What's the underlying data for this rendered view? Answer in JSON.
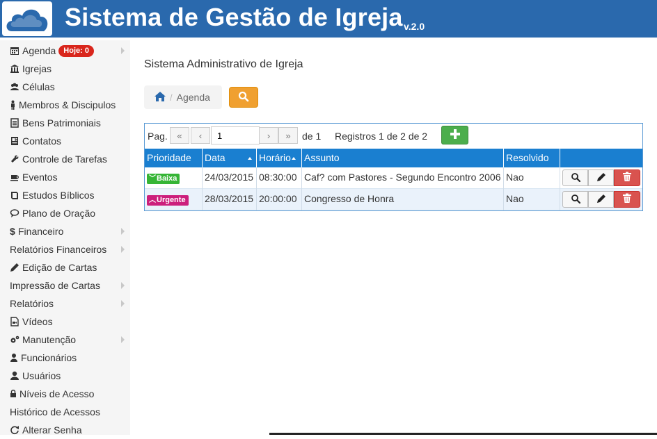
{
  "header": {
    "title": "Sistema de Gestão de Igreja",
    "version": "v.2.0"
  },
  "sidebar": {
    "items": [
      {
        "label": "Agenda",
        "icon": "calendar-icon",
        "badge": "Hoje: 0",
        "submenu": true
      },
      {
        "label": "Igrejas",
        "icon": "bank-icon",
        "submenu": false
      },
      {
        "label": "Células",
        "icon": "users-icon",
        "submenu": false
      },
      {
        "label": "Membros & Discipulos",
        "icon": "person-icon",
        "submenu": false
      },
      {
        "label": "Bens Patrimoniais",
        "icon": "list-icon",
        "submenu": false
      },
      {
        "label": "Contatos",
        "icon": "contacts-icon",
        "submenu": false
      },
      {
        "label": "Controle de Tarefas",
        "icon": "wrench-icon",
        "submenu": false
      },
      {
        "label": "Eventos",
        "icon": "coffee-icon",
        "submenu": false
      },
      {
        "label": "Estudos Bíblicos",
        "icon": "book-icon",
        "submenu": false
      },
      {
        "label": "Plano de Oração",
        "icon": "comment-icon",
        "submenu": false
      },
      {
        "label": "Financeiro",
        "icon": "dollar-icon",
        "submenu": true
      },
      {
        "label": "Relatórios Financeiros",
        "icon": "",
        "submenu": true
      },
      {
        "label": "Edição de Cartas",
        "icon": "pencil-icon",
        "submenu": false
      },
      {
        "label": "Impressão de Cartas",
        "icon": "",
        "submenu": true
      },
      {
        "label": "Relatórios",
        "icon": "",
        "submenu": true
      },
      {
        "label": "Vídeos",
        "icon": "video-file-icon",
        "submenu": false
      },
      {
        "label": "Manutenção",
        "icon": "gears-icon",
        "submenu": true
      },
      {
        "label": "Funcionários",
        "icon": "user-icon",
        "submenu": false
      },
      {
        "label": "Usuários",
        "icon": "user-icon",
        "submenu": false
      },
      {
        "label": "Níveis de Acesso",
        "icon": "lock-icon",
        "submenu": false
      },
      {
        "label": "Histórico de Acessos",
        "icon": "",
        "submenu": false
      },
      {
        "label": "Alterar Senha",
        "icon": "refresh-icon",
        "submenu": false
      }
    ]
  },
  "main": {
    "page_title": "Sistema Administrativo de Igreja",
    "breadcrumb": {
      "home_icon": "home-icon",
      "current": "Agenda"
    },
    "pager": {
      "label": "Pag.",
      "page": "1",
      "of_label": "de 1",
      "records": "Registros 1 de 2 de 2"
    },
    "table": {
      "columns": [
        "Prioridade",
        "Data",
        "Horário",
        "Assunto",
        "Resolvido"
      ],
      "rows": [
        {
          "priority": "Baixa",
          "priority_icon": "chevron-down-icon",
          "date": "24/03/2015",
          "time": "08:30:00",
          "subject": "Caf? com Pastores - Segundo Encontro 2006",
          "resolved": "Nao"
        },
        {
          "priority": "Urgente",
          "priority_icon": "chevron-up-icon",
          "date": "28/03/2015",
          "time": "20:00:00",
          "subject": "Congresso de Honra",
          "resolved": "Nao"
        }
      ]
    }
  },
  "colors": {
    "header": "#2a69ad",
    "table_header": "#1a7fd0",
    "badge": "#d9261c",
    "low": "#36b536",
    "urgent": "#cc1f7c",
    "search_button": "#f0a030",
    "add_button": "#4cae4c",
    "delete_button": "#d9534f"
  }
}
